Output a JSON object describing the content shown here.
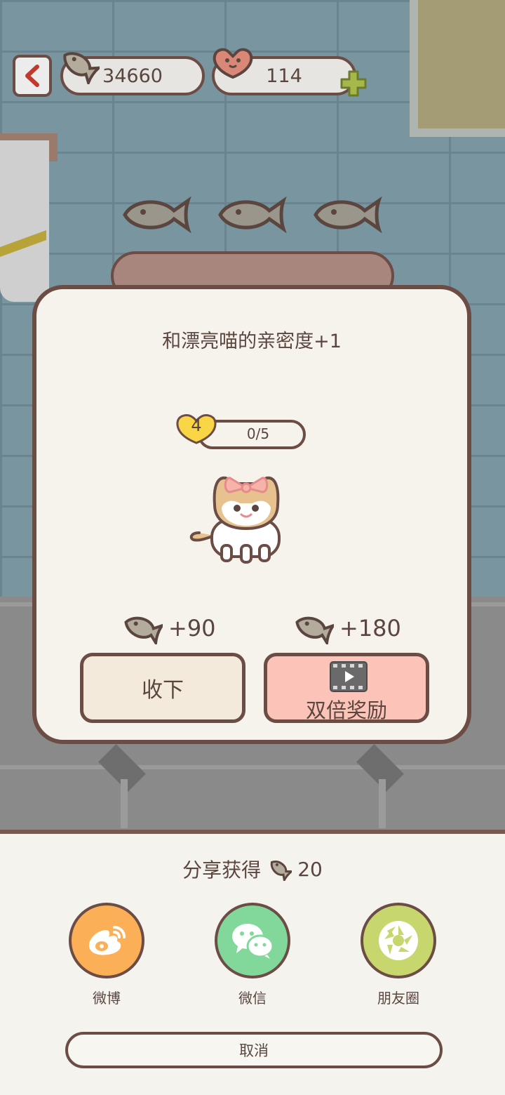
{
  "top_bar": {
    "back_icon": "chevron-left-icon",
    "fish_count": "34660",
    "heart_count": "114",
    "add_icon": "plus-icon"
  },
  "modal": {
    "title": "和漂亮喵的亲密度+1",
    "level": "4",
    "progress_text": "0/5",
    "progress_fraction": 0,
    "reward_normal": "+90",
    "reward_double": "+180",
    "accept_label": "收下",
    "double_label": "双倍奖励"
  },
  "share": {
    "title": "分享获得",
    "reward": "20",
    "items": [
      {
        "label": "微博",
        "icon": "weibo-icon",
        "color": "#fbb058"
      },
      {
        "label": "微信",
        "icon": "wechat-icon",
        "color": "#82d79a"
      },
      {
        "label": "朋友圈",
        "icon": "moments-icon",
        "color": "#c7d66d"
      }
    ],
    "cancel_label": "取消"
  },
  "colors": {
    "outline": "#6b4d45",
    "modal_bg": "#f6f3ec",
    "accept_bg": "#f4eadc",
    "double_bg": "#fcc4b8",
    "heart_yellow": "#f8d646",
    "plus_green": "#a6b84a"
  }
}
